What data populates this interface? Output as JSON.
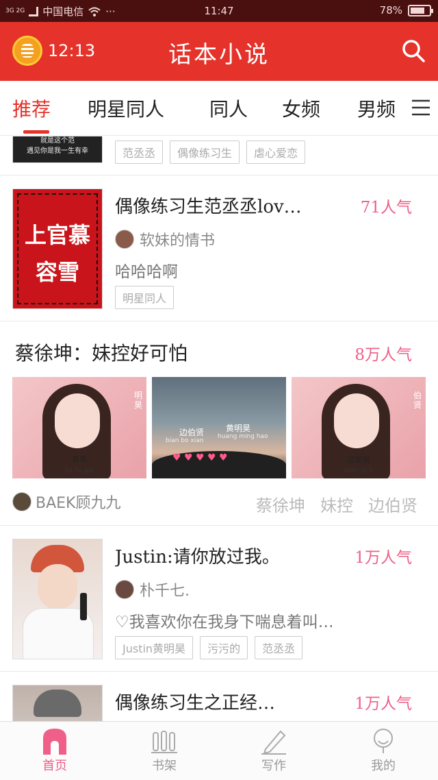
{
  "status_bar": {
    "network": "3G 2G",
    "carrier": "中国电信",
    "dots": "···",
    "time": "11:47",
    "battery": "78%",
    "battery_level": 0.78
  },
  "header": {
    "timer": "12:13",
    "title": "话本小说",
    "accent": "#e5322a"
  },
  "tabs": [
    {
      "label": "推荐",
      "active": true
    },
    {
      "label": "明星同人"
    },
    {
      "label": "同人"
    },
    {
      "label": "女频"
    },
    {
      "label": "男频"
    }
  ],
  "top_partial": {
    "cover_text": "就是这个范",
    "cover_sub": "遇见你是我一生有幸",
    "tags": [
      "范丞丞",
      "偶像练习生",
      "虐心爱恋"
    ]
  },
  "book1": {
    "cover_lines": [
      "上官慕",
      "容雪"
    ],
    "title": "偶像练习生范丞丞lov…",
    "popularity": "71人气",
    "author": "软妹的情书",
    "desc": "哈哈哈啊",
    "tags": [
      "明星同人"
    ]
  },
  "feature": {
    "title": "蔡徐坤：妹控好可怕",
    "popularity": "8万人气",
    "thumbs": [
      {
        "caption": "哥哥",
        "sub": "jia fu gui",
        "side": "明昊"
      },
      {
        "caption": "边伯贤",
        "caption2": "黄明昊",
        "sub": "bian bo xian",
        "sub2": "huang ming hao"
      },
      {
        "caption": "边爱丽",
        "sub": "bian ai li",
        "side": "伯贤"
      }
    ],
    "author": "BAEK顾九九",
    "tags": [
      "蔡徐坤",
      "妹控",
      "边伯贤"
    ]
  },
  "book2": {
    "title": "Justin:请你放过我。",
    "popularity": "1万人气",
    "author": "朴千七.",
    "desc": "♡我喜欢你在我身下喘息着叫…",
    "tags": [
      "Justin黄明昊",
      "污污的",
      "范丞丞"
    ]
  },
  "book3": {
    "title": "偶像练习生之正经…",
    "popularity": "1万人气"
  },
  "bottom_nav": [
    {
      "label": "首页",
      "icon": "home-icon",
      "active": true
    },
    {
      "label": "书架",
      "icon": "bookshelf-icon"
    },
    {
      "label": "写作",
      "icon": "pen-icon"
    },
    {
      "label": "我的",
      "icon": "profile-icon"
    }
  ],
  "colors": {
    "pink": "#ef5f88",
    "red": "#e5322a"
  }
}
